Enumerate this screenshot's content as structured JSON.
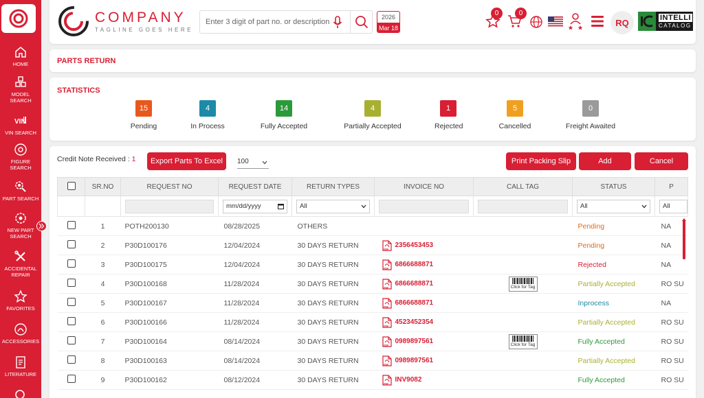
{
  "sidebar": {
    "items": [
      {
        "label": "HOME",
        "icon": "home-icon"
      },
      {
        "label": "MODEL SEARCH",
        "icon": "cubes-icon"
      },
      {
        "label": "VIN SEARCH",
        "icon": "vin-icon"
      },
      {
        "label": "FIGURE SEARCH",
        "icon": "figure-icon"
      },
      {
        "label": "PART SEARCH",
        "icon": "gear-search-icon"
      },
      {
        "label": "NEW PART SEARCH",
        "icon": "new-part-icon"
      },
      {
        "label": "ACCIDENTAL REPAIR",
        "icon": "wrench-icon"
      },
      {
        "label": "FAVORITES",
        "icon": "star-icon"
      },
      {
        "label": "ACCESSORIES",
        "icon": "accessories-icon"
      },
      {
        "label": "LITERATURE",
        "icon": "document-icon"
      }
    ]
  },
  "header": {
    "brand_name": "COMPANY",
    "tagline": "TAGLINE GOES HERE",
    "search_placeholder": "Enter 3 digit of part no. or description",
    "date_year": "2026",
    "date_day": "Mar 18",
    "favorites_count": "0",
    "cart_count": "0",
    "avatar_initials": "RQ",
    "intelli_line1": "INTELLI",
    "intelli_line2": "CATALOG"
  },
  "page": {
    "title": "PARTS RETURN"
  },
  "statistics": {
    "title": "STATISTICS",
    "items": [
      {
        "label": "Pending",
        "value": "15",
        "color": "#e8581c"
      },
      {
        "label": "In Process",
        "value": "4",
        "color": "#1c8aa8"
      },
      {
        "label": "Fully Accepted",
        "value": "14",
        "color": "#2a9a3a"
      },
      {
        "label": "Partially Accepted",
        "value": "4",
        "color": "#a8b030"
      },
      {
        "label": "Rejected",
        "value": "1",
        "color": "#d81f34"
      },
      {
        "label": "Cancelled",
        "value": "5",
        "color": "#f0a020"
      },
      {
        "label": "Freight Awaited",
        "value": "0",
        "color": "#9a9a9a"
      }
    ]
  },
  "toolbar": {
    "credit_label": "Credit Note Received :",
    "credit_value": "1",
    "export_label": "Export Parts To Excel",
    "page_size": "100",
    "print_label": "Print Packing Slip",
    "add_label": "Add",
    "cancel_label": "Cancel"
  },
  "table": {
    "columns": [
      "SR.NO",
      "REQUEST NO",
      "REQUEST DATE",
      "RETURN TYPES",
      "INVOICE NO",
      "CALL TAG",
      "STATUS",
      "P"
    ],
    "filters": {
      "date_placeholder": "mm/dd/yyyy",
      "return_type": "All",
      "status": "All",
      "last": "All"
    },
    "tag_label": "Click for Tag",
    "rows": [
      {
        "sr": "1",
        "req": "POTH200130",
        "date": "08/28/2025",
        "type": "OTHERS",
        "invoice": "",
        "tag": false,
        "status": "Pending",
        "cls": "st-pending",
        "last": "NA"
      },
      {
        "sr": "2",
        "req": "P30D100176",
        "date": "12/04/2024",
        "type": "30 DAYS RETURN",
        "invoice": "2356453453",
        "tag": false,
        "status": "Pending",
        "cls": "st-pending",
        "last": "NA"
      },
      {
        "sr": "3",
        "req": "P30D100175",
        "date": "12/04/2024",
        "type": "30 DAYS RETURN",
        "invoice": "6866688871",
        "tag": false,
        "status": "Rejected",
        "cls": "st-rejected",
        "last": "NA"
      },
      {
        "sr": "4",
        "req": "P30D100168",
        "date": "11/28/2024",
        "type": "30 DAYS RETURN",
        "invoice": "6866688871",
        "tag": true,
        "status": "Partially Accepted",
        "cls": "st-partial",
        "last": "RO SU"
      },
      {
        "sr": "5",
        "req": "P30D100167",
        "date": "11/28/2024",
        "type": "30 DAYS RETURN",
        "invoice": "6866688871",
        "tag": false,
        "status": "Inprocess",
        "cls": "st-inprocess",
        "last": "NA"
      },
      {
        "sr": "6",
        "req": "P30D100166",
        "date": "11/28/2024",
        "type": "30 DAYS RETURN",
        "invoice": "4523452354",
        "tag": false,
        "status": "Partially Accepted",
        "cls": "st-partial",
        "last": "RO SU"
      },
      {
        "sr": "7",
        "req": "P30D100164",
        "date": "08/14/2024",
        "type": "30 DAYS RETURN",
        "invoice": "0989897561",
        "tag": true,
        "status": "Fully Accepted",
        "cls": "st-full",
        "last": "RO SU"
      },
      {
        "sr": "8",
        "req": "P30D100163",
        "date": "08/14/2024",
        "type": "30 DAYS RETURN",
        "invoice": "0989897561",
        "tag": false,
        "status": "Partially Accepted",
        "cls": "st-partial",
        "last": "RO SU"
      },
      {
        "sr": "9",
        "req": "P30D100162",
        "date": "08/12/2024",
        "type": "30 DAYS RETURN",
        "invoice": "INV9082",
        "tag": false,
        "status": "Fully Accepted",
        "cls": "st-full",
        "last": "RO SU"
      }
    ]
  }
}
